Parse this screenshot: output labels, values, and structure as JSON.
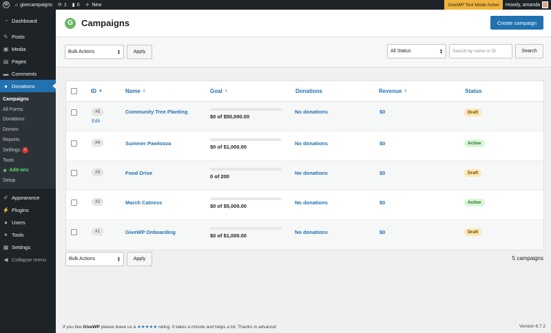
{
  "adminbar": {
    "site": "givecampaigns",
    "updates": "1",
    "comments": "0",
    "new": "New",
    "test_mode": "GiveWP Test Mode Active",
    "howdy": "Howdy, amanda"
  },
  "sidebar": {
    "items_top": [
      {
        "label": "Dashboard",
        "icon": "dashboard-icon"
      },
      {
        "label": "Posts",
        "icon": "pin-icon"
      },
      {
        "label": "Media",
        "icon": "media-icon"
      },
      {
        "label": "Pages",
        "icon": "pages-icon"
      },
      {
        "label": "Comments",
        "icon": "comment-icon"
      }
    ],
    "donations": "Donations",
    "sub": [
      {
        "label": "Campaigns"
      },
      {
        "label": "All Forms"
      },
      {
        "label": "Donations"
      },
      {
        "label": "Donors"
      },
      {
        "label": "Reports"
      },
      {
        "label": "Settings",
        "badge": "1"
      },
      {
        "label": "Tools"
      },
      {
        "label": "Add-ons"
      },
      {
        "label": "Setup"
      }
    ],
    "items_bottom": [
      {
        "label": "Appearance",
        "icon": "brush-icon"
      },
      {
        "label": "Plugins",
        "icon": "plug-icon"
      },
      {
        "label": "Users",
        "icon": "user-icon"
      },
      {
        "label": "Tools",
        "icon": "wrench-icon"
      },
      {
        "label": "Settings",
        "icon": "settings-icon"
      }
    ],
    "collapse": "Collapse menu"
  },
  "header": {
    "title": "Campaigns",
    "create_button": "Create campaign"
  },
  "toolbar": {
    "bulk_actions": "Bulk Actions",
    "apply": "Apply",
    "status_filter": "All Status",
    "search_placeholder": "Search by name or ID",
    "search_button": "Search"
  },
  "table": {
    "columns": {
      "id": "ID",
      "name": "Name",
      "goal": "Goal",
      "donations": "Donations",
      "revenue": "Revenue",
      "status": "Status"
    },
    "rows": [
      {
        "id": "5",
        "name": "Community Tree Planting",
        "goal": "$0 of $50,000.00",
        "donations": "No donations",
        "revenue": "$0",
        "status": "Draft",
        "edit": "Edit",
        "progress": 0
      },
      {
        "id": "4",
        "name": "Summer Pawlooza",
        "goal": "$0 of $1,000.00",
        "donations": "No donations",
        "revenue": "$0",
        "status": "Active",
        "progress": 0
      },
      {
        "id": "3",
        "name": "Food Drive",
        "goal": "0 of 200",
        "donations": "No donations",
        "revenue": "$0",
        "status": "Draft",
        "progress": 0
      },
      {
        "id": "2",
        "name": "March Catness",
        "goal": "$0 of $5,000.00",
        "donations": "No donations",
        "revenue": "$0",
        "status": "Active",
        "progress": 0
      },
      {
        "id": "1",
        "name": "GiveWP Onboarding",
        "goal": "$0 of $1,000.00",
        "donations": "No donations",
        "revenue": "$0",
        "status": "Draft",
        "progress": 0
      }
    ]
  },
  "bottom": {
    "bulk_actions": "Bulk Actions",
    "apply": "Apply",
    "count": "5 campaigns"
  },
  "footer": {
    "text_a": "If you like ",
    "brand": "GiveWP",
    "text_b": " please leave us a ",
    "stars": "★★★★★",
    "text_c": " rating. It takes a minute and helps a lot. Thanks in advance!",
    "version": "Version 6.7.2"
  },
  "colors": {
    "accent": "#2271b1",
    "admin_dark": "#1d2327",
    "test_mode": "#f0b33b",
    "draft": "#fde6b4",
    "active": "#daf5d9"
  }
}
